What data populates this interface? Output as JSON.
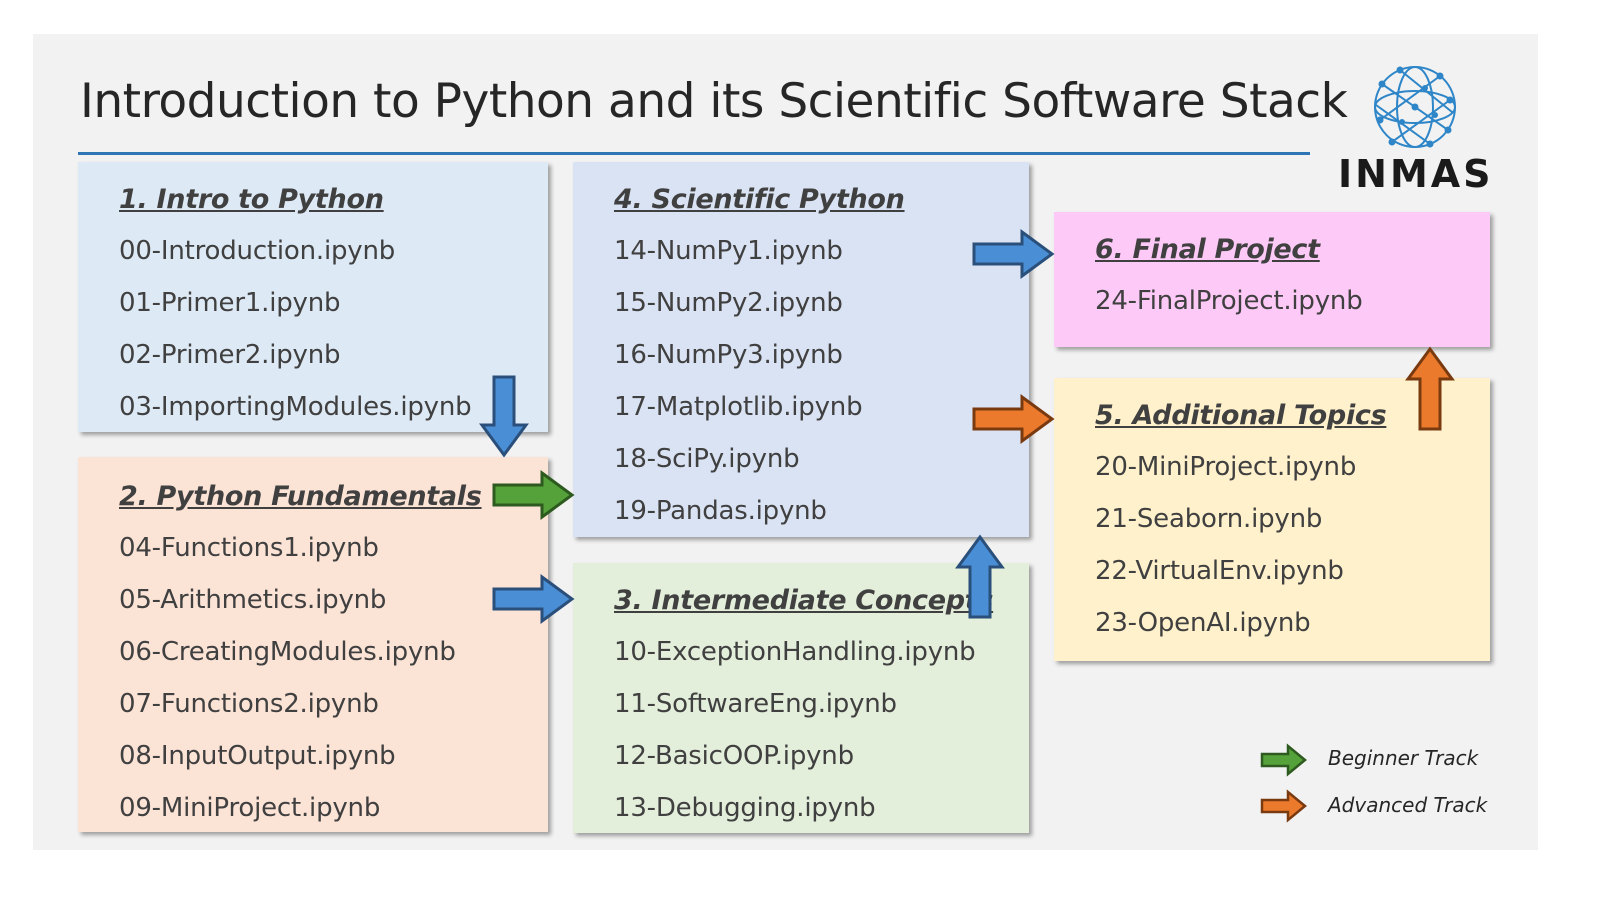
{
  "title": "Introduction to Python and its Scientific Software Stack",
  "logo": {
    "text": "INMAS"
  },
  "colors": {
    "accent_rule": "#2e75b6",
    "blue_arrow": "#4a8fd6",
    "green_arrow": "#56a23a",
    "orange_arrow": "#ec7a2c",
    "box1": "#dde9f5",
    "box2": "#fbe3d6",
    "box3": "#e3eedb",
    "box4": "#dae3f3",
    "box5": "#fff1cc",
    "box6": "#fdcaf8"
  },
  "sections": [
    {
      "heading": "1. Intro to Python",
      "items": [
        "00-Introduction.ipynb",
        "01-Primer1.ipynb",
        "02-Primer2.ipynb",
        "03-ImportingModules.ipynb"
      ]
    },
    {
      "heading": "2. Python Fundamentals",
      "items": [
        "04-Functions1.ipynb",
        "05-Arithmetics.ipynb",
        "06-CreatingModules.ipynb",
        "07-Functions2.ipynb",
        "08-InputOutput.ipynb",
        "09-MiniProject.ipynb"
      ]
    },
    {
      "heading": "3. Intermediate Concepts",
      "items": [
        "10-ExceptionHandling.ipynb",
        "11-SoftwareEng.ipynb",
        "12-BasicOOP.ipynb",
        "13-Debugging.ipynb"
      ]
    },
    {
      "heading": "4. Scientific Python",
      "items": [
        "14-NumPy1.ipynb",
        "15-NumPy2.ipynb",
        "16-NumPy3.ipynb",
        "17-Matplotlib.ipynb",
        "18-SciPy.ipynb",
        "19-Pandas.ipynb"
      ]
    },
    {
      "heading": "5. Additional Topics",
      "items": [
        "20-MiniProject.ipynb",
        "21-Seaborn.ipynb",
        "22-VirtualEnv.ipynb",
        "23-OpenAI.ipynb"
      ]
    },
    {
      "heading": "6. Final Project",
      "items": [
        "24-FinalProject.ipynb"
      ]
    }
  ],
  "legend": [
    {
      "label": "Beginner Track",
      "color": "green"
    },
    {
      "label": "Advanced Track",
      "color": "orange"
    }
  ]
}
